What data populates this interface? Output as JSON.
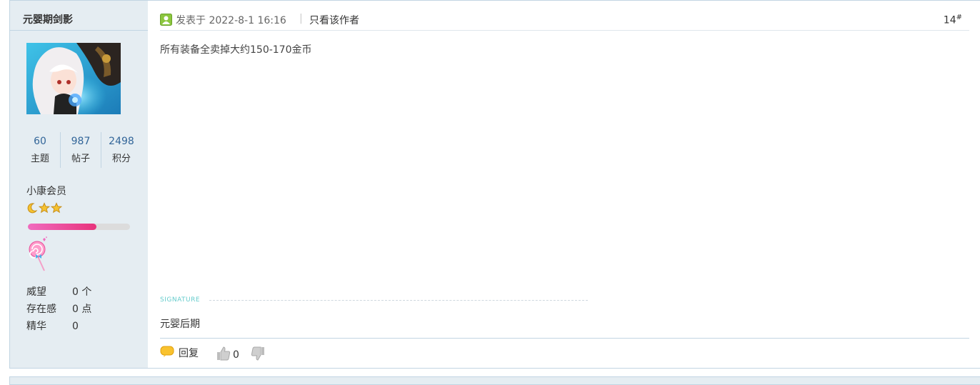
{
  "author": {
    "name": "元婴期剑影",
    "avatar_icon": "anime-avatar",
    "stats": [
      {
        "value": "60",
        "label": "主题"
      },
      {
        "value": "987",
        "label": "帖子"
      },
      {
        "value": "2498",
        "label": "积分"
      }
    ],
    "rank": "小康会员",
    "rank_icons": [
      "moon-icon",
      "star-icon",
      "star-icon"
    ],
    "level_progress": 0.67,
    "medal_icon": "lollipop-icon",
    "extra": [
      {
        "key": "威望",
        "value": "0 个"
      },
      {
        "key": "存在感",
        "value": "0 点"
      },
      {
        "key": "精华",
        "value": "0"
      }
    ]
  },
  "post": {
    "posted_at": "发表于 2022-8-1 16:16",
    "separator": "|",
    "only_author": "只看该作者",
    "floor": "14",
    "floor_suffix": "#",
    "content": "所有装备全卖掉大约150-170金币",
    "signature_label": "SIGNATURE",
    "signature": "元婴后期",
    "reply_label": "回复",
    "like_count": "0"
  },
  "colors": {
    "sidebar_bg": "#e5edf2",
    "border": "#c2d5e3",
    "link_blue": "#336699",
    "progress_pink": "#e8337b"
  }
}
